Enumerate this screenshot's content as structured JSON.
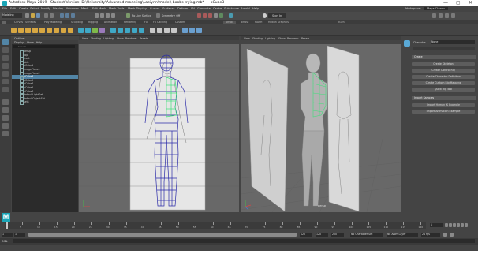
{
  "window": {
    "title": "Autodesk Maya 2019 - Student Version: D:\\University\\Advanced modeling\\Laeiynn\\model\\ boobs trying.mb* --- pCube3",
    "controls": [
      "—",
      "▢",
      "✕"
    ]
  },
  "menubar": {
    "items": [
      "File",
      "Edit",
      "Create",
      "Select",
      "Modify",
      "Display",
      "Windows",
      "Mesh",
      "Edit Mesh",
      "Mesh Tools",
      "Mesh Display",
      "Curves",
      "Surfaces",
      "Deform",
      "UV",
      "Generate",
      "Cache",
      "Substance",
      "Arnold",
      "Help"
    ],
    "workspace_label": "Workspace:",
    "workspace_value": "Maya Classic"
  },
  "status": {
    "mode": "Modeling",
    "no_live_surface": "No Live Surface",
    "symmetry": "Symmetry: Off",
    "sign_in": "Sign In"
  },
  "shelf": {
    "tabs": [
      "Curves / Surfaces",
      "Poly Modeling",
      "Sculpting",
      "Rigging",
      "Animation",
      "Rendering",
      "FX",
      "FX Caching",
      "Custom",
      "Arnold",
      "Bifrost",
      "MASH",
      "Motion Graphics",
      "XGen"
    ],
    "active_tab": "Poly Modeling"
  },
  "outliner": {
    "title": "Outliner",
    "menu": [
      "Display",
      "Show",
      "Help"
    ],
    "search_placeholder": "Search...",
    "items": [
      "persp",
      "top",
      "front",
      "side",
      "pCube1",
      "imagePlane1",
      "imagePlane2",
      "pCube3",
      "pCube2",
      "pCube4",
      "pCube5",
      "pCube6",
      "defaultLightSet",
      "defaultObjectSet",
      "set1"
    ],
    "selected": "pCube3"
  },
  "viewport_left": {
    "menu": [
      "View",
      "Shading",
      "Lighting",
      "Show",
      "Renderer",
      "Panels"
    ]
  },
  "viewport_right": {
    "menu": [
      "View",
      "Shading",
      "Lighting",
      "Show",
      "Renderer",
      "Panels"
    ],
    "camera_label": "persp"
  },
  "character_panel": {
    "character_label": "Character",
    "character_value": "None",
    "create_section": "Create",
    "create_buttons": [
      "Create Skeleton",
      "Create Control Rig",
      "Create Character Definition",
      "Create Custom Rig Mapping",
      "Quick Rig Tool"
    ],
    "import_section": "Import Samples",
    "import_buttons": [
      "Import Human IK Example",
      "Import Animation Example"
    ]
  },
  "timeline": {
    "ticks": [
      "5",
      "10",
      "15",
      "20",
      "25",
      "30",
      "35",
      "40",
      "45",
      "50",
      "55",
      "60",
      "65",
      "70",
      "75",
      "80",
      "85",
      "90",
      "95",
      "100",
      "105",
      "110",
      "115",
      "120"
    ],
    "current_frame": "1"
  },
  "range": {
    "start": "1",
    "start_inner": "1",
    "end_inner": "120",
    "end": "120",
    "end2": "200",
    "character_set": "No Character Set",
    "anim_layer": "No Anim Layer",
    "fps": "24 fps"
  },
  "cmdline": {
    "label": "MEL"
  }
}
